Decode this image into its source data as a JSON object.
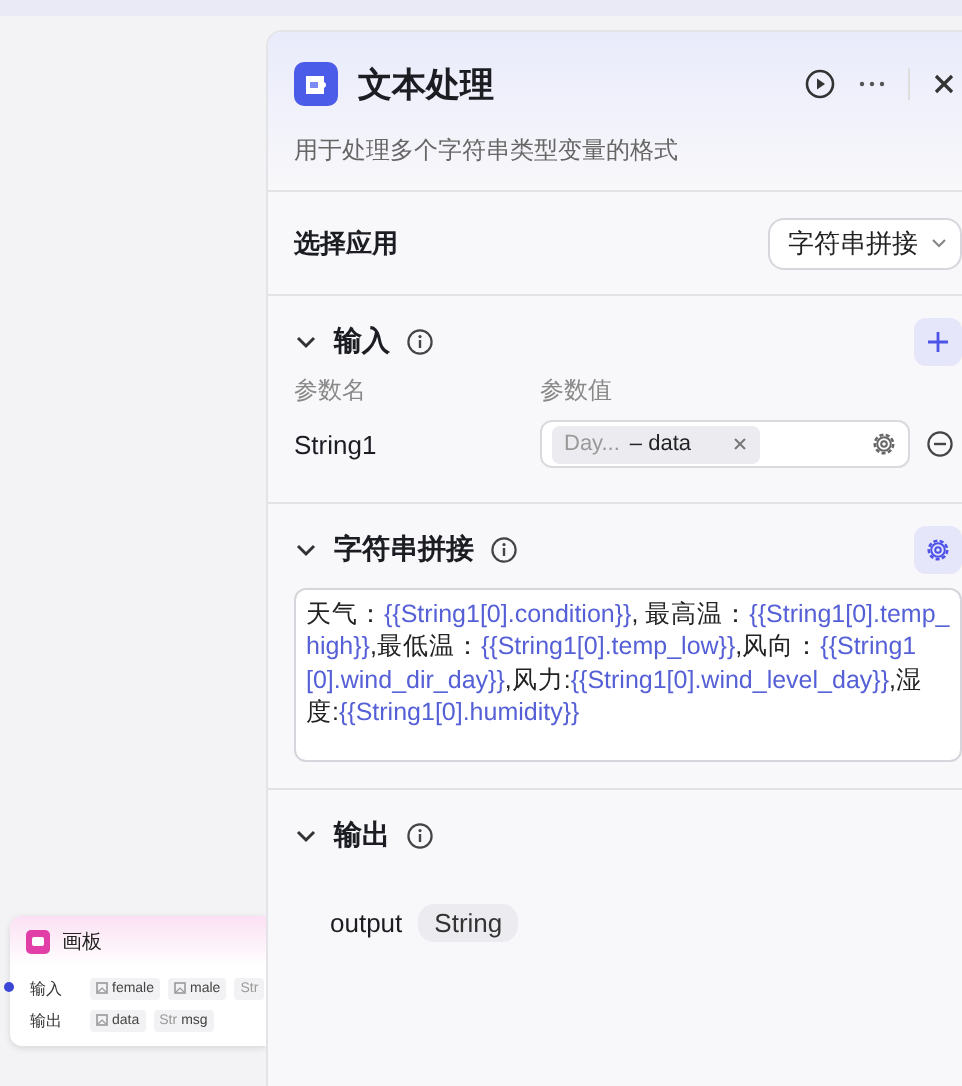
{
  "canvas_node": {
    "title": "画板",
    "rows": [
      {
        "label": "输入",
        "ports": [
          {
            "kind": "image",
            "name": "female"
          },
          {
            "kind": "image",
            "name": "male"
          },
          {
            "kind": "string",
            "type_label": "Str"
          }
        ]
      },
      {
        "label": "输出",
        "ports": [
          {
            "kind": "image",
            "name": "data"
          },
          {
            "kind": "string",
            "type_label": "Str",
            "name": "msg"
          }
        ]
      }
    ]
  },
  "panel": {
    "title": "文本处理",
    "description": "用于处理多个字符串类型变量的格式",
    "app_select": {
      "label": "选择应用",
      "value": "字符串拼接"
    },
    "sections": [
      {
        "kind": "input",
        "title": "输入",
        "expanded": true,
        "columns": [
          "参数名",
          "参数值"
        ],
        "params": [
          {
            "name": "String1",
            "ref_node": "Day...",
            "ref_field": "– data"
          }
        ]
      },
      {
        "kind": "template",
        "title": "字符串拼接",
        "expanded": true,
        "segments": [
          {
            "kind": "text",
            "text": "天气："
          },
          {
            "kind": "var",
            "text": "{{String1[0].condition}}"
          },
          {
            "kind": "text",
            "text": ", 最高温："
          },
          {
            "kind": "var",
            "text": "{{String1[0].temp_high}}"
          },
          {
            "kind": "text",
            "text": ",最低温："
          },
          {
            "kind": "var",
            "text": "{{String1[0].temp_low}}"
          },
          {
            "kind": "text",
            "text": ",风向："
          },
          {
            "kind": "var",
            "text": "{{String1[0].wind_dir_day}}"
          },
          {
            "kind": "text",
            "text": ",风力:"
          },
          {
            "kind": "var",
            "text": "{{String1[0].wind_level_day}}"
          },
          {
            "kind": "text",
            "text": ",湿度:"
          },
          {
            "kind": "var",
            "text": "{{String1[0].humidity}}"
          }
        ]
      },
      {
        "kind": "output",
        "title": "输出",
        "expanded": true,
        "outputs": [
          {
            "name": "output",
            "type": "String"
          }
        ]
      }
    ]
  }
}
